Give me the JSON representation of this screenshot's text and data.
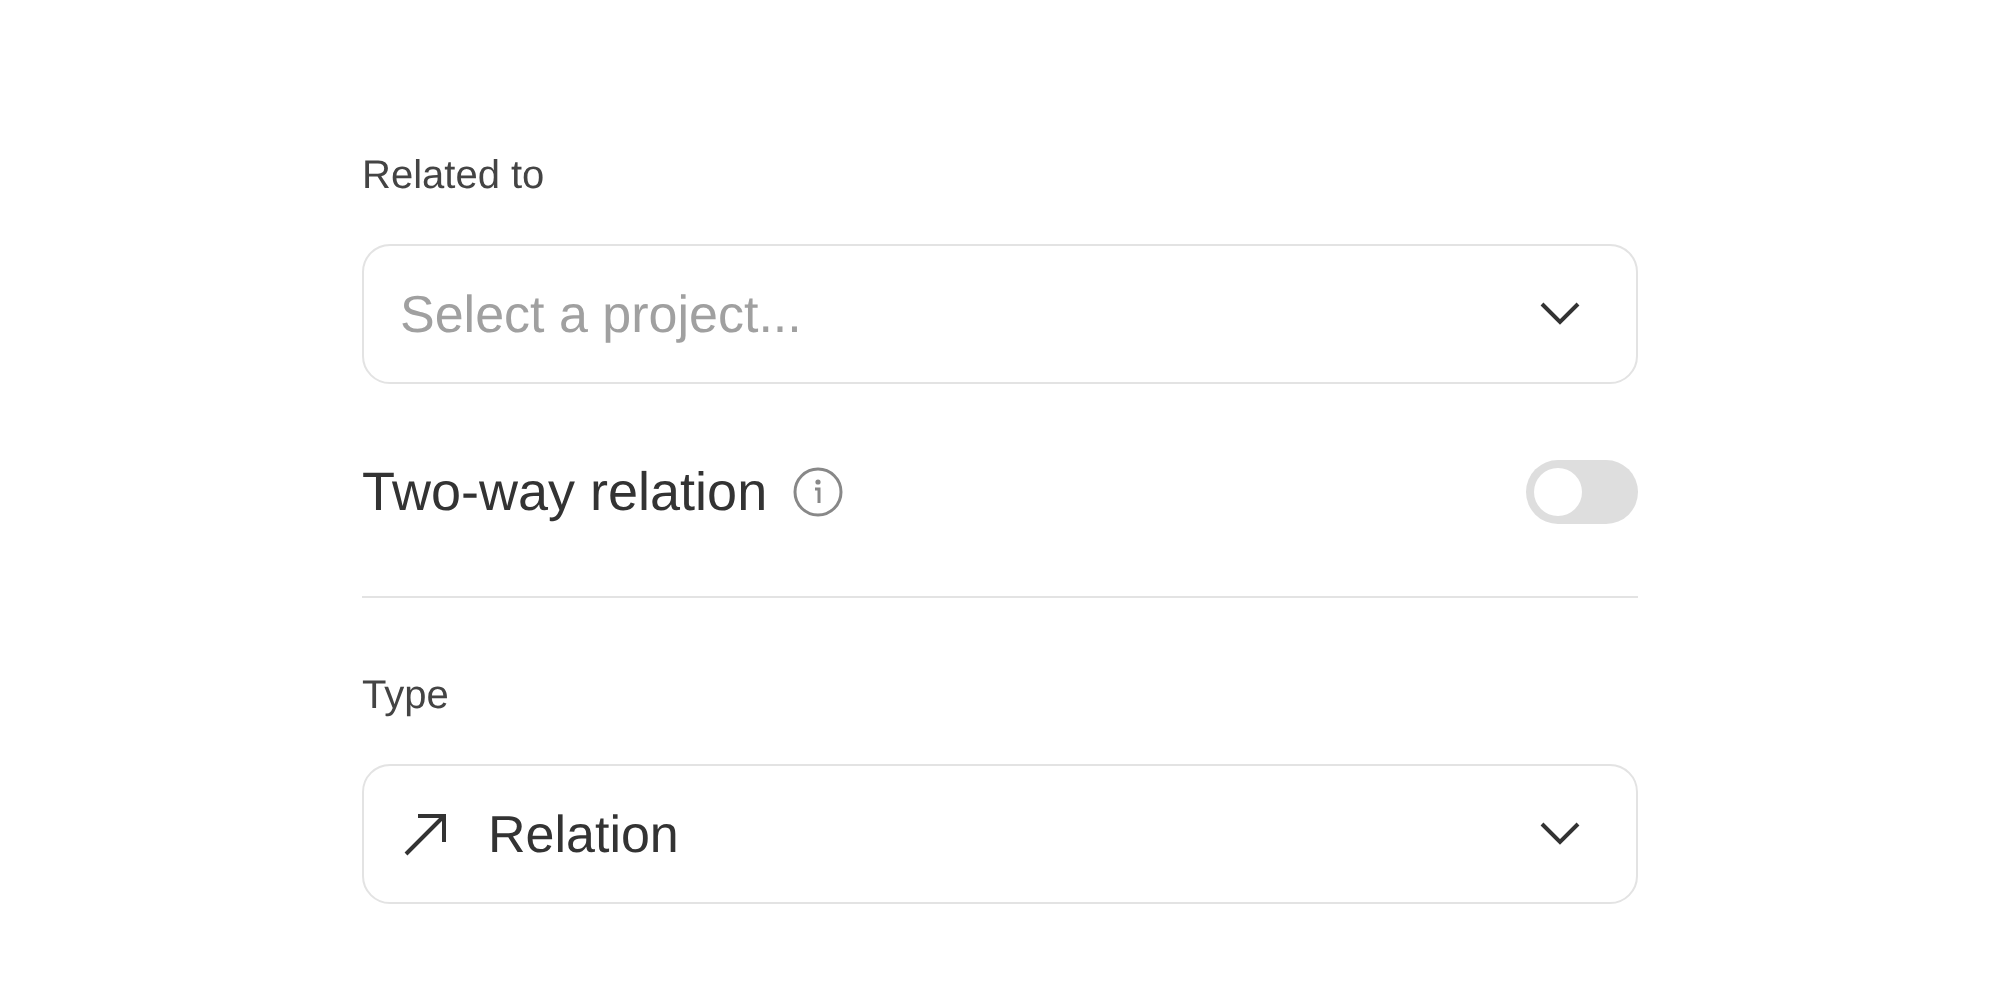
{
  "fields": [
    {
      "kind": "select",
      "label": "Related to",
      "placeholder": "Select a project..."
    },
    {
      "kind": "toggle",
      "label": "Two-way relation",
      "on": false
    },
    {
      "kind": "divider"
    },
    {
      "kind": "select",
      "label": "Type",
      "value": "Relation"
    }
  ]
}
